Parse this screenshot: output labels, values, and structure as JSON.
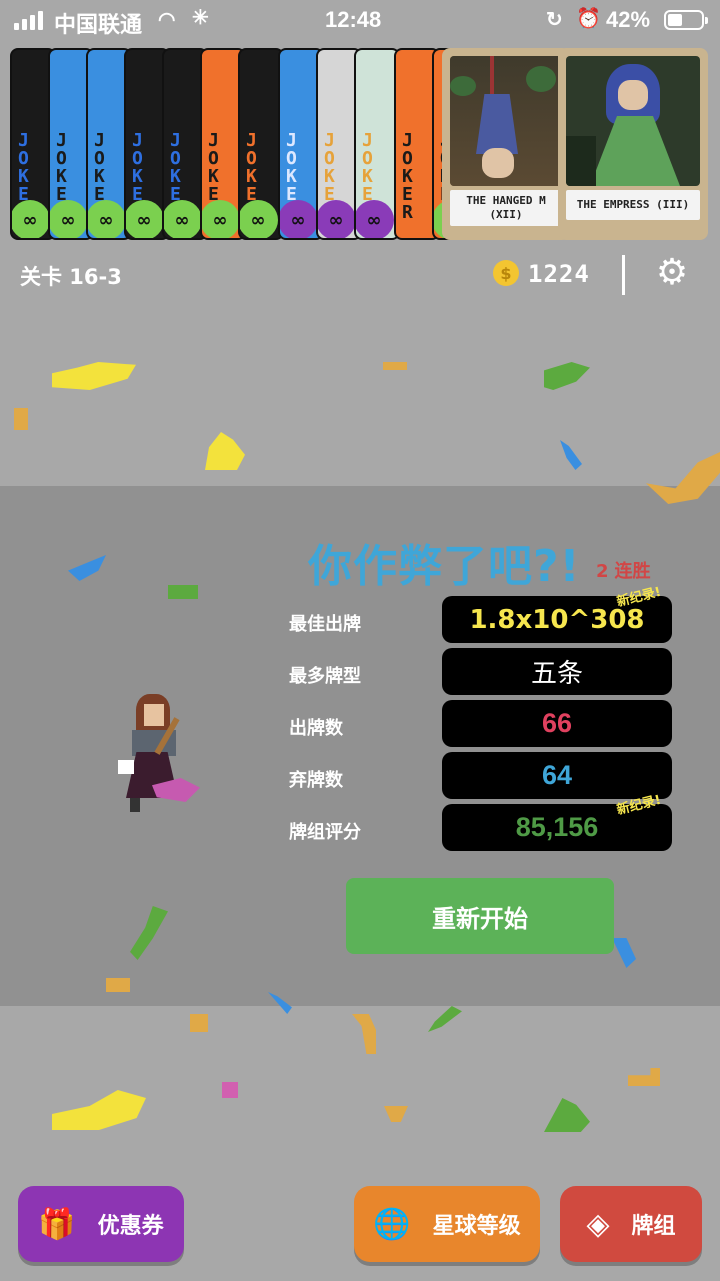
{
  "status_bar": {
    "carrier": "中国联通",
    "time": "12:48",
    "battery_pct": "42%",
    "icons": [
      "signal-icon",
      "wifi-icon",
      "loading-icon",
      "rotation-lock-icon",
      "alarm-icon",
      "battery-icon"
    ]
  },
  "jokers": [
    {
      "text": "JOKE",
      "color": "#1a1a1a",
      "text_color": "#2e6fe0",
      "badge": "∞",
      "badge_color": "#7bd04f"
    },
    {
      "text": "JOKE",
      "color": "#3a8fe0",
      "text_color": "#1a1a1a",
      "badge": "∞",
      "badge_color": "#7bd04f"
    },
    {
      "text": "JOKE",
      "color": "#3a8fe0",
      "text_color": "#1a1a1a",
      "badge": "∞",
      "badge_color": "#7bd04f"
    },
    {
      "text": "JOKE",
      "color": "#1a1a1a",
      "text_color": "#2e6fe0",
      "badge": "∞",
      "badge_color": "#7bd04f"
    },
    {
      "text": "JOKE",
      "color": "#1a1a1a",
      "text_color": "#2e6fe0",
      "badge": "∞",
      "badge_color": "#7bd04f"
    },
    {
      "text": "JOKE",
      "color": "#f0712c",
      "text_color": "#1a1a1a",
      "badge": "∞",
      "badge_color": "#7bd04f"
    },
    {
      "text": "JOKE",
      "color": "#1a1a1a",
      "text_color": "#f0712c",
      "badge": "∞",
      "badge_color": "#7bd04f"
    },
    {
      "text": "JOKE",
      "color": "#3a8fe0",
      "text_color": "#dde8ff",
      "badge": "∞",
      "badge_color": "#8a3bb8"
    },
    {
      "text": "JOKE",
      "color": "#d6d6d6",
      "text_color": "#e6a23a",
      "badge": "∞",
      "badge_color": "#8a3bb8"
    },
    {
      "text": "JOKE",
      "color": "#cfe3d8",
      "text_color": "#e6a23a",
      "badge": "∞",
      "badge_color": "#8a3bb8"
    },
    {
      "text": "JOKER",
      "color": "#f0712c",
      "text_color": "#1a1a1a",
      "badge": "",
      "badge_color": ""
    },
    {
      "text": "JOKE",
      "color": "#f0712c",
      "text_color": "#1a1a1a",
      "badge": "∞",
      "badge_color": "#7bd04f"
    }
  ],
  "tarots": [
    {
      "name": "THE HANGED M",
      "numeral": "(XII)"
    },
    {
      "name": "THE EMPRESS (III)",
      "numeral": ""
    }
  ],
  "info": {
    "level": "关卡 16-3",
    "coins": "1224",
    "coin_symbol": "$"
  },
  "result": {
    "headline": "你作弊了吧?!",
    "streak_count": "2",
    "streak_label": "连胜",
    "new_record": "新纪录!",
    "stats": [
      {
        "label": "最佳出牌",
        "value": "1.8x10^308",
        "color": "#f6e64e",
        "record": true
      },
      {
        "label": "最多牌型",
        "value": "五条",
        "color": "#ffffff",
        "record": false
      },
      {
        "label": "出牌数",
        "value": "66",
        "color": "#e0415f",
        "record": false
      },
      {
        "label": "弃牌数",
        "value": "64",
        "color": "#3fa6d8",
        "record": false
      },
      {
        "label": "牌组评分",
        "value": "85,156",
        "color": "#4f9a46",
        "record": true
      }
    ],
    "restart_label": "重新开始"
  },
  "bottom_buttons": {
    "coupon": "优惠券",
    "planet": "星球等级",
    "deck": "牌组"
  }
}
